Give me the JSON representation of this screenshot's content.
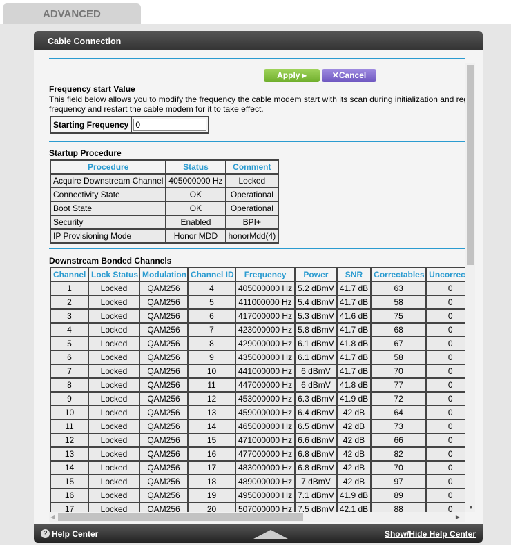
{
  "tab": "ADVANCED",
  "panel_title": "Cable Connection",
  "buttons": {
    "apply": "Apply ▸",
    "cancel": "✕Cancel"
  },
  "freq": {
    "heading": "Frequency start Value",
    "desc1": "This field below allows you to modify the frequency the cable modem start with its scan during initialization and register",
    "desc2": "frequency and restart the cable modem for it to take effect.",
    "label": "Starting Frequency",
    "value": "0"
  },
  "startup": {
    "heading": "Startup Procedure",
    "headers": [
      "Procedure",
      "Status",
      "Comment"
    ],
    "rows": [
      [
        "Acquire Downstream Channel",
        "405000000 Hz",
        "Locked"
      ],
      [
        "Connectivity State",
        "OK",
        "Operational"
      ],
      [
        "Boot State",
        "OK",
        "Operational"
      ],
      [
        "Security",
        "Enabled",
        "BPI+"
      ],
      [
        "IP Provisioning Mode",
        "Honor MDD",
        "honorMdd(4)"
      ]
    ]
  },
  "downstream": {
    "heading": "Downstream Bonded Channels",
    "headers": [
      "Channel",
      "Lock Status",
      "Modulation",
      "Channel ID",
      "Frequency",
      "Power",
      "SNR",
      "Correctables",
      "Uncorrectables"
    ],
    "rows": [
      [
        "1",
        "Locked",
        "QAM256",
        "4",
        "405000000 Hz",
        "5.2 dBmV",
        "41.7 dB",
        "63",
        "0"
      ],
      [
        "2",
        "Locked",
        "QAM256",
        "5",
        "411000000 Hz",
        "5.4 dBmV",
        "41.7 dB",
        "58",
        "0"
      ],
      [
        "3",
        "Locked",
        "QAM256",
        "6",
        "417000000 Hz",
        "5.3 dBmV",
        "41.6 dB",
        "75",
        "0"
      ],
      [
        "4",
        "Locked",
        "QAM256",
        "7",
        "423000000 Hz",
        "5.8 dBmV",
        "41.7 dB",
        "68",
        "0"
      ],
      [
        "5",
        "Locked",
        "QAM256",
        "8",
        "429000000 Hz",
        "6.1 dBmV",
        "41.8 dB",
        "67",
        "0"
      ],
      [
        "6",
        "Locked",
        "QAM256",
        "9",
        "435000000 Hz",
        "6.1 dBmV",
        "41.7 dB",
        "58",
        "0"
      ],
      [
        "7",
        "Locked",
        "QAM256",
        "10",
        "441000000 Hz",
        "6 dBmV",
        "41.7 dB",
        "70",
        "0"
      ],
      [
        "8",
        "Locked",
        "QAM256",
        "11",
        "447000000 Hz",
        "6 dBmV",
        "41.8 dB",
        "77",
        "0"
      ],
      [
        "9",
        "Locked",
        "QAM256",
        "12",
        "453000000 Hz",
        "6.3 dBmV",
        "41.9 dB",
        "72",
        "0"
      ],
      [
        "10",
        "Locked",
        "QAM256",
        "13",
        "459000000 Hz",
        "6.4 dBmV",
        "42 dB",
        "64",
        "0"
      ],
      [
        "11",
        "Locked",
        "QAM256",
        "14",
        "465000000 Hz",
        "6.5 dBmV",
        "42 dB",
        "73",
        "0"
      ],
      [
        "12",
        "Locked",
        "QAM256",
        "15",
        "471000000 Hz",
        "6.6 dBmV",
        "42 dB",
        "66",
        "0"
      ],
      [
        "13",
        "Locked",
        "QAM256",
        "16",
        "477000000 Hz",
        "6.8 dBmV",
        "42 dB",
        "82",
        "0"
      ],
      [
        "14",
        "Locked",
        "QAM256",
        "17",
        "483000000 Hz",
        "6.8 dBmV",
        "42 dB",
        "70",
        "0"
      ],
      [
        "15",
        "Locked",
        "QAM256",
        "18",
        "489000000 Hz",
        "7 dBmV",
        "42 dB",
        "97",
        "0"
      ],
      [
        "16",
        "Locked",
        "QAM256",
        "19",
        "495000000 Hz",
        "7.1 dBmV",
        "41.9 dB",
        "89",
        "0"
      ],
      [
        "17",
        "Locked",
        "QAM256",
        "20",
        "507000000 Hz",
        "7.5 dBmV",
        "42.1 dB",
        "88",
        "0"
      ]
    ]
  },
  "footer": {
    "help": "Help Center",
    "toggle": "Show/Hide Help Center"
  },
  "colors": {
    "accent": "#2b9bd0",
    "apply": "#7fbf3a",
    "cancel": "#7e68cc"
  }
}
